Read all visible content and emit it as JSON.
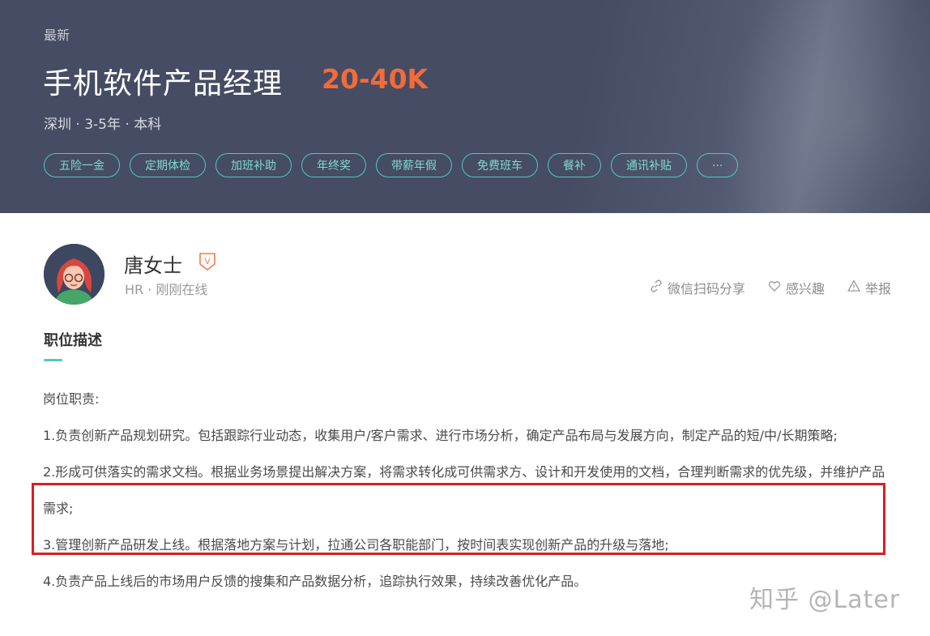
{
  "header": {
    "tag": "最新",
    "title": "手机软件产品经理",
    "salary": "20-40K",
    "meta": "深圳 · 3-5年 · 本科",
    "benefits": [
      "五险一金",
      "定期体检",
      "加班补助",
      "年终奖",
      "带薪年假",
      "免费班车",
      "餐补",
      "通讯补贴",
      "···"
    ]
  },
  "recruiter": {
    "name": "唐女士",
    "role_status": "HR ·  刚刚在线",
    "badge_letter": "V",
    "colors": {
      "badge": "#f07c4a"
    }
  },
  "actions": {
    "share": "微信扫码分享",
    "interest": "感兴趣",
    "report": "举报"
  },
  "section": {
    "title": "职位描述",
    "accent": "#4fc8c1"
  },
  "description": {
    "heading": "岗位职责:",
    "items": [
      "1.负责创新产品规划研究。包括跟踪行业动态，收集用户/客户需求、进行市场分析，确定产品布局与发展方向，制定产品的短/中/长期策略;",
      "2.形成可供落实的需求文档。根据业务场景提出解决方案，将需求转化成可供需求方、设计和开发使用的文档，合理判断需求的优先级，并维护产品需求;",
      "3.管理创新产品研发上线。根据落地方案与计划，拉通公司各职能部门，按时间表实现创新产品的升级与落地;",
      "4.负责产品上线后的市场用户反馈的搜集和产品数据分析，追踪执行效果，持续改善优化产品。"
    ]
  },
  "watermark": "知乎 @Later",
  "colors": {
    "header_bg": "#454c63",
    "salary": "#f26b3a",
    "tag_border": "#4fc8c1",
    "highlight": "#d81e24"
  }
}
